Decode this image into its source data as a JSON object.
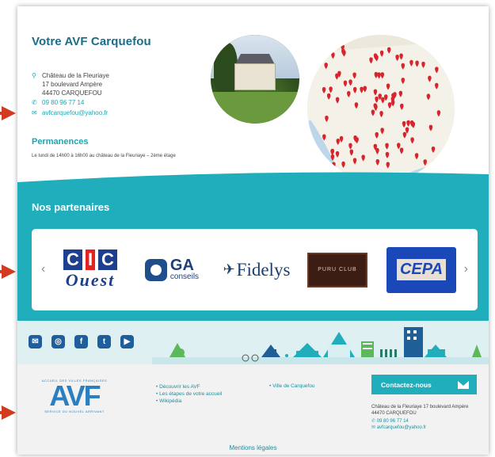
{
  "section": {
    "title": "Votre AVF Carquefou",
    "address_lines": [
      "Château de la Fleuriaye",
      "17 boulevard Ampère",
      "44470 CARQUEFOU"
    ],
    "phone": "09 80 96 77 14",
    "email": "avfcarquefou@yahoo.fr",
    "permanences_title": "Permanences",
    "permanences_text": "Le lundi de 14h00 à 16h00 au château de la Fleuriaye – 2ème étage"
  },
  "partners": {
    "title": "Nos partenaires",
    "prev": "‹",
    "next": "›",
    "cic_letters": [
      "C",
      "I",
      "C"
    ],
    "cic_sub": "Ouest",
    "ga_name": "GA",
    "ga_sub": "conseils",
    "fidelys": "Fidelys",
    "puru": "PURU CLUB",
    "cepa": "CEPA"
  },
  "social": {
    "icons": [
      "mail-icon",
      "instagram-icon",
      "facebook-icon",
      "twitter-icon",
      "youtube-icon"
    ],
    "glyphs": [
      "✉",
      "◎",
      "f",
      "t",
      "▶"
    ]
  },
  "footer": {
    "logo_top": "ACCUEIL DES VILLES FRANÇAISES",
    "logo_main": "AVF",
    "logo_bottom": "SERVICE DU NOUVEL ARRIVANT",
    "links_col1": [
      "Découvrir les AVF",
      "Les étapes de votre accueil",
      "Wikipédia"
    ],
    "links_col2": [
      "Ville de Carquefou"
    ],
    "contact_title": "Contactez-nous",
    "contact_address": "Château de la Fleuriaye 17 boulevard Ampère 44470 CARQUEFOU",
    "contact_phone": "09 80 96 77 14",
    "contact_email": "avfcarquefou@yahoo.fr",
    "mentions": "Mentions légales"
  },
  "colors": {
    "teal": "#21aebc",
    "title_blue": "#1b6c8a",
    "arrow_red": "#d23b1f"
  }
}
